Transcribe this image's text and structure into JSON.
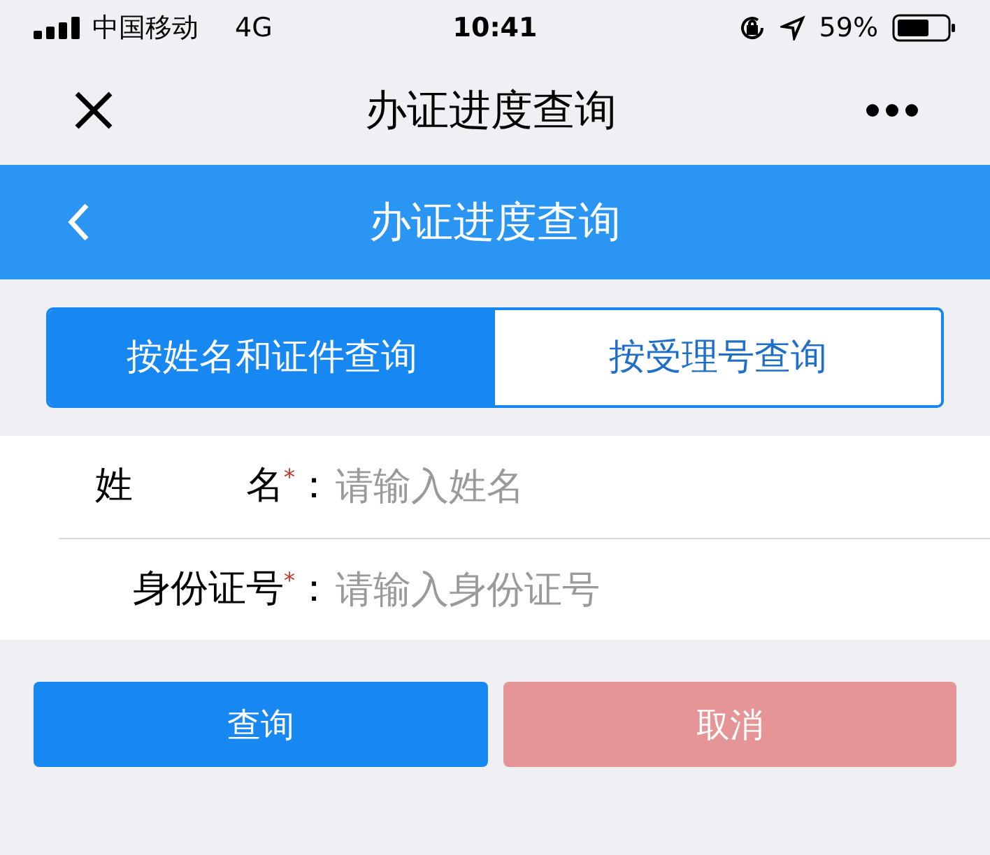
{
  "status_bar": {
    "carrier": "中国移动",
    "network": "4G",
    "time": "10:41",
    "battery": "59%"
  },
  "nav_bar": {
    "title": "办证进度查询"
  },
  "header": {
    "title": "办证进度查询"
  },
  "tabs": [
    {
      "label": "按姓名和证件查询",
      "selected": true
    },
    {
      "label": "按受理号查询",
      "selected": false
    }
  ],
  "fields": [
    {
      "label": "姓　　　名",
      "required_mark": "*",
      "colon": "：",
      "placeholder": "请输入姓名"
    },
    {
      "label": "身份证号",
      "required_mark": "*",
      "colon": "：",
      "placeholder": "请输入身份证号"
    }
  ],
  "buttons": [
    {
      "label": "查询",
      "kind": "primary"
    },
    {
      "label": "取消",
      "kind": "cancel"
    }
  ]
}
